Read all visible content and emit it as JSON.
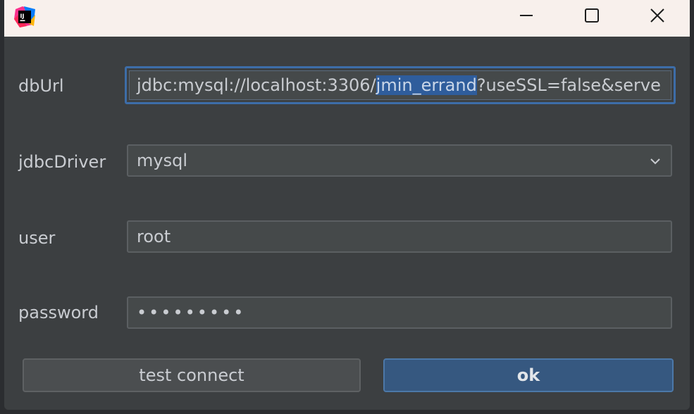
{
  "titlebar": {
    "app_icon": "intellij-idea-icon",
    "minimize_icon": "minimize-icon",
    "maximize_icon": "maximize-icon",
    "close_icon": "close-icon"
  },
  "form": {
    "dbUrl": {
      "label": "dbUrl",
      "value_prefix": "jdbc:mysql://localhost:3306/",
      "value_selected": "jmin_errand",
      "value_suffix": "?useSSL=false&serve"
    },
    "jdbcDriver": {
      "label": "jdbcDriver",
      "value": "mysql",
      "dropdown_icon": "chevron-down-icon"
    },
    "user": {
      "label": "user",
      "value": "root"
    },
    "password": {
      "label": "password",
      "value": "•••••••••"
    }
  },
  "buttons": {
    "test_connect": "test connect",
    "ok": "ok"
  },
  "colors": {
    "background": "#3c3f41",
    "titlebar": "#f8f0ec",
    "accent": "#3d6da8",
    "ok_button": "#365880",
    "text": "#c9ccd1"
  }
}
